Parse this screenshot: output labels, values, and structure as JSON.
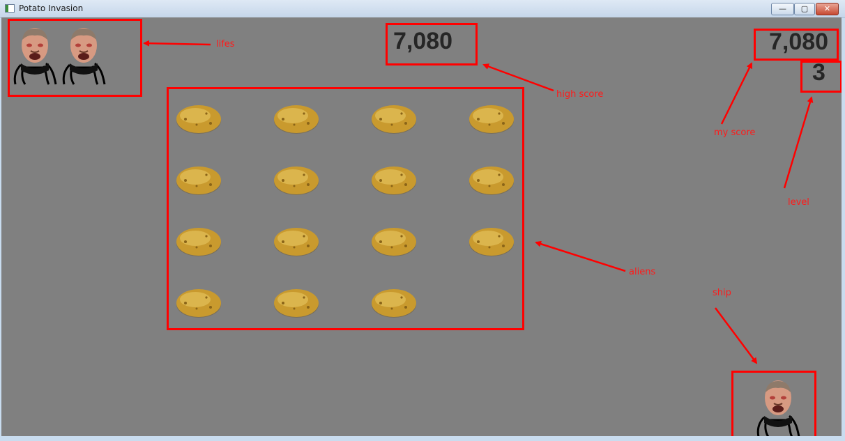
{
  "window": {
    "title": "Potato Invasion",
    "min_glyph": "—",
    "max_glyph": "▢",
    "close_glyph": "✕"
  },
  "hud": {
    "high_score": "7,080",
    "my_score": "7,080",
    "level": "3"
  },
  "lives": {
    "count": 2
  },
  "aliens": {
    "rows": 4,
    "cols": 4,
    "count": 15
  },
  "annotations": {
    "lifes": "lifes",
    "high_score": "high score",
    "my_score": "my score",
    "level": "level",
    "aliens": "aliens",
    "ship": "ship"
  },
  "colors": {
    "background": "#808080",
    "annotation": "#ff0000",
    "score_text": "#262626"
  }
}
